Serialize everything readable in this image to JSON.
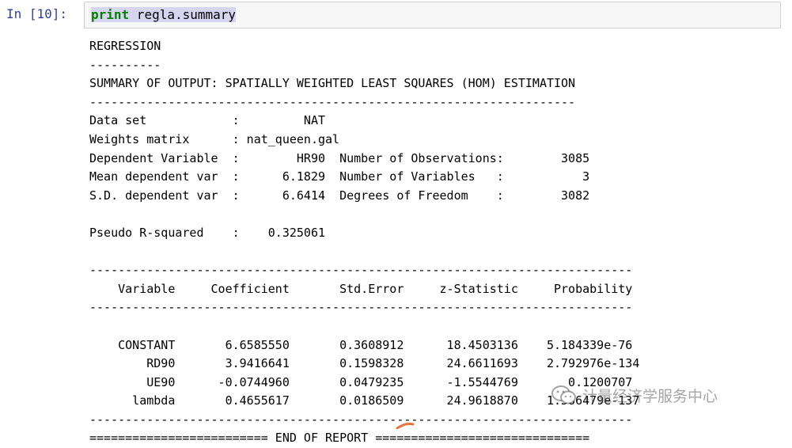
{
  "cell": {
    "prompt": "In  [10]:",
    "code_keyword": "print",
    "code_rest": " regla.summary"
  },
  "output_lines": [
    "REGRESSION",
    "----------",
    "SUMMARY OF OUTPUT: SPATIALLY WEIGHTED LEAST SQUARES (HOM) ESTIMATION",
    "--------------------------------------------------------------------",
    "Data set            :         NAT",
    "Weights matrix      : nat_queen.gal",
    "Dependent Variable  :        HR90  Number of Observations:        3085",
    "Mean dependent var  :      6.1829  Number of Variables   :           3",
    "S.D. dependent var  :      6.6414  Degrees of Freedom    :        3082",
    "",
    "Pseudo R-squared    :    0.325061",
    "",
    "----------------------------------------------------------------------------",
    "    Variable     Coefficient       Std.Error     z-Statistic     Probability",
    "----------------------------------------------------------------------------",
    "",
    "    CONSTANT       6.6585550       0.3608912      18.4503136    5.184339e-76",
    "        RD90       3.9416641       0.1598328      24.6611693    2.792976e-134",
    "        UE90      -0.0744960       0.0479235      -1.5544769       0.1200707",
    "      lambda       0.4655617       0.0186509      24.9618870    1.586479e-137",
    "----------------------------------------------------------------------------",
    "========================= END OF REPORT =============================="
  ],
  "watermark": {
    "text": "计量经济学服务中心",
    "icon": "wechat-icon"
  },
  "colors": {
    "prompt": "#303f9f",
    "keyword": "#008000",
    "cell_bg": "#f7f7f7",
    "cell_border": "#cfcfcf",
    "selection": "#d7d4f0",
    "cursor_mark": "#e8743b"
  }
}
